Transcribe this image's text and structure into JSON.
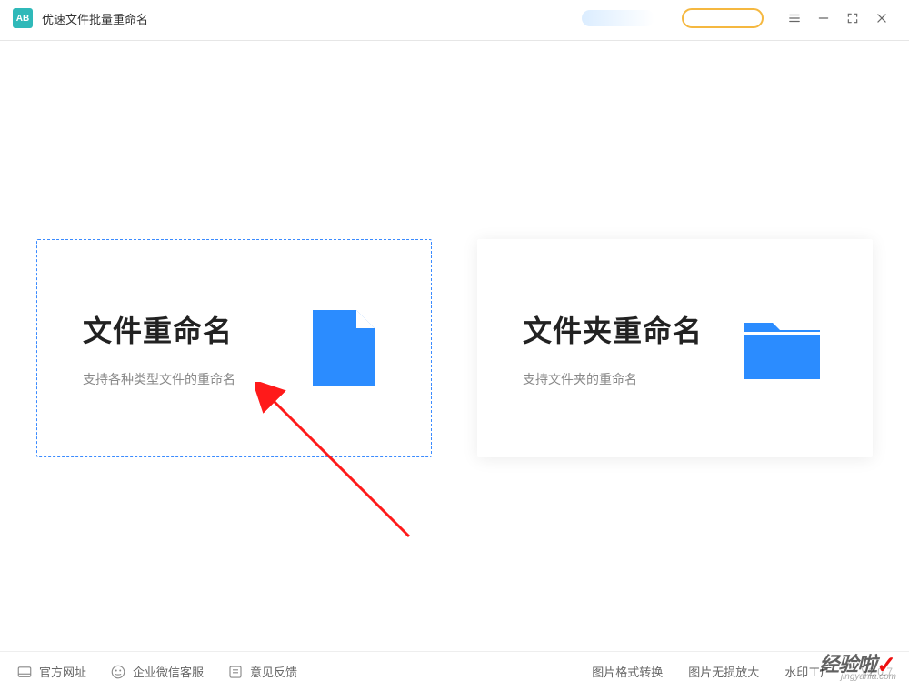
{
  "app": {
    "iconText": "AB",
    "title": "优速文件批量重命名"
  },
  "cards": {
    "file": {
      "title": "文件重命名",
      "sub": "支持各种类型文件的重命名"
    },
    "folder": {
      "title": "文件夹重命名",
      "sub": "支持文件夹的重命名"
    }
  },
  "footer": {
    "official": "官方网址",
    "wechat": "企业微信客服",
    "feedback": "意见反馈",
    "link1": "图片格式转换",
    "link2": "图片无损放大",
    "link3": "水印工厂",
    "version": "V2.0.7"
  },
  "watermark": {
    "text": "经验啦",
    "url": "jingyanla.com"
  }
}
